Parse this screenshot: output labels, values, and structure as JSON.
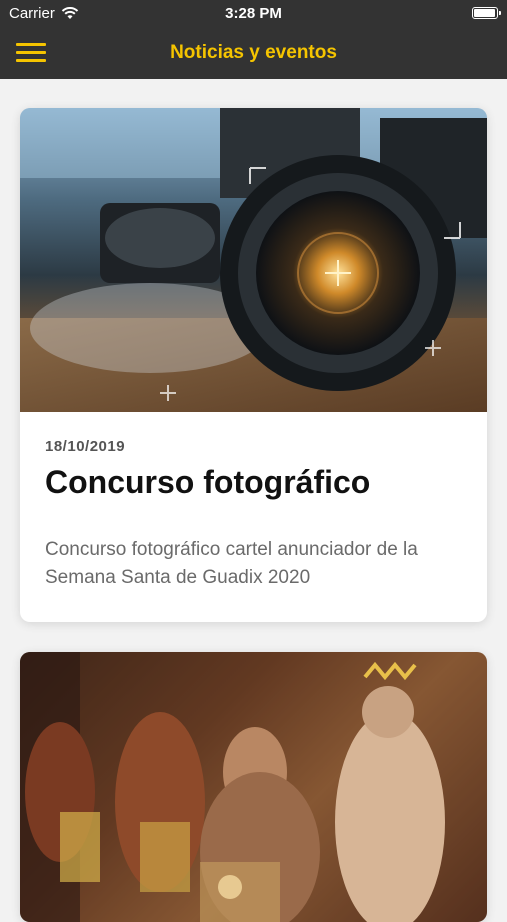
{
  "status_bar": {
    "carrier": "Carrier",
    "time": "3:28 PM",
    "battery_level": 1.0
  },
  "nav": {
    "title": "Noticias y eventos",
    "menu_icon": "hamburger-menu-icon",
    "accent_color": "#f5c400",
    "bar_color": "#333333"
  },
  "news": [
    {
      "date": "18/10/2019",
      "title": "Concurso fotográfico",
      "description": "Concurso fotográfico cartel anunciador de la Semana Santa de Guadix 2020",
      "image": "camera-lens-photo"
    },
    {
      "image": "holy-week-procession-photo"
    }
  ]
}
